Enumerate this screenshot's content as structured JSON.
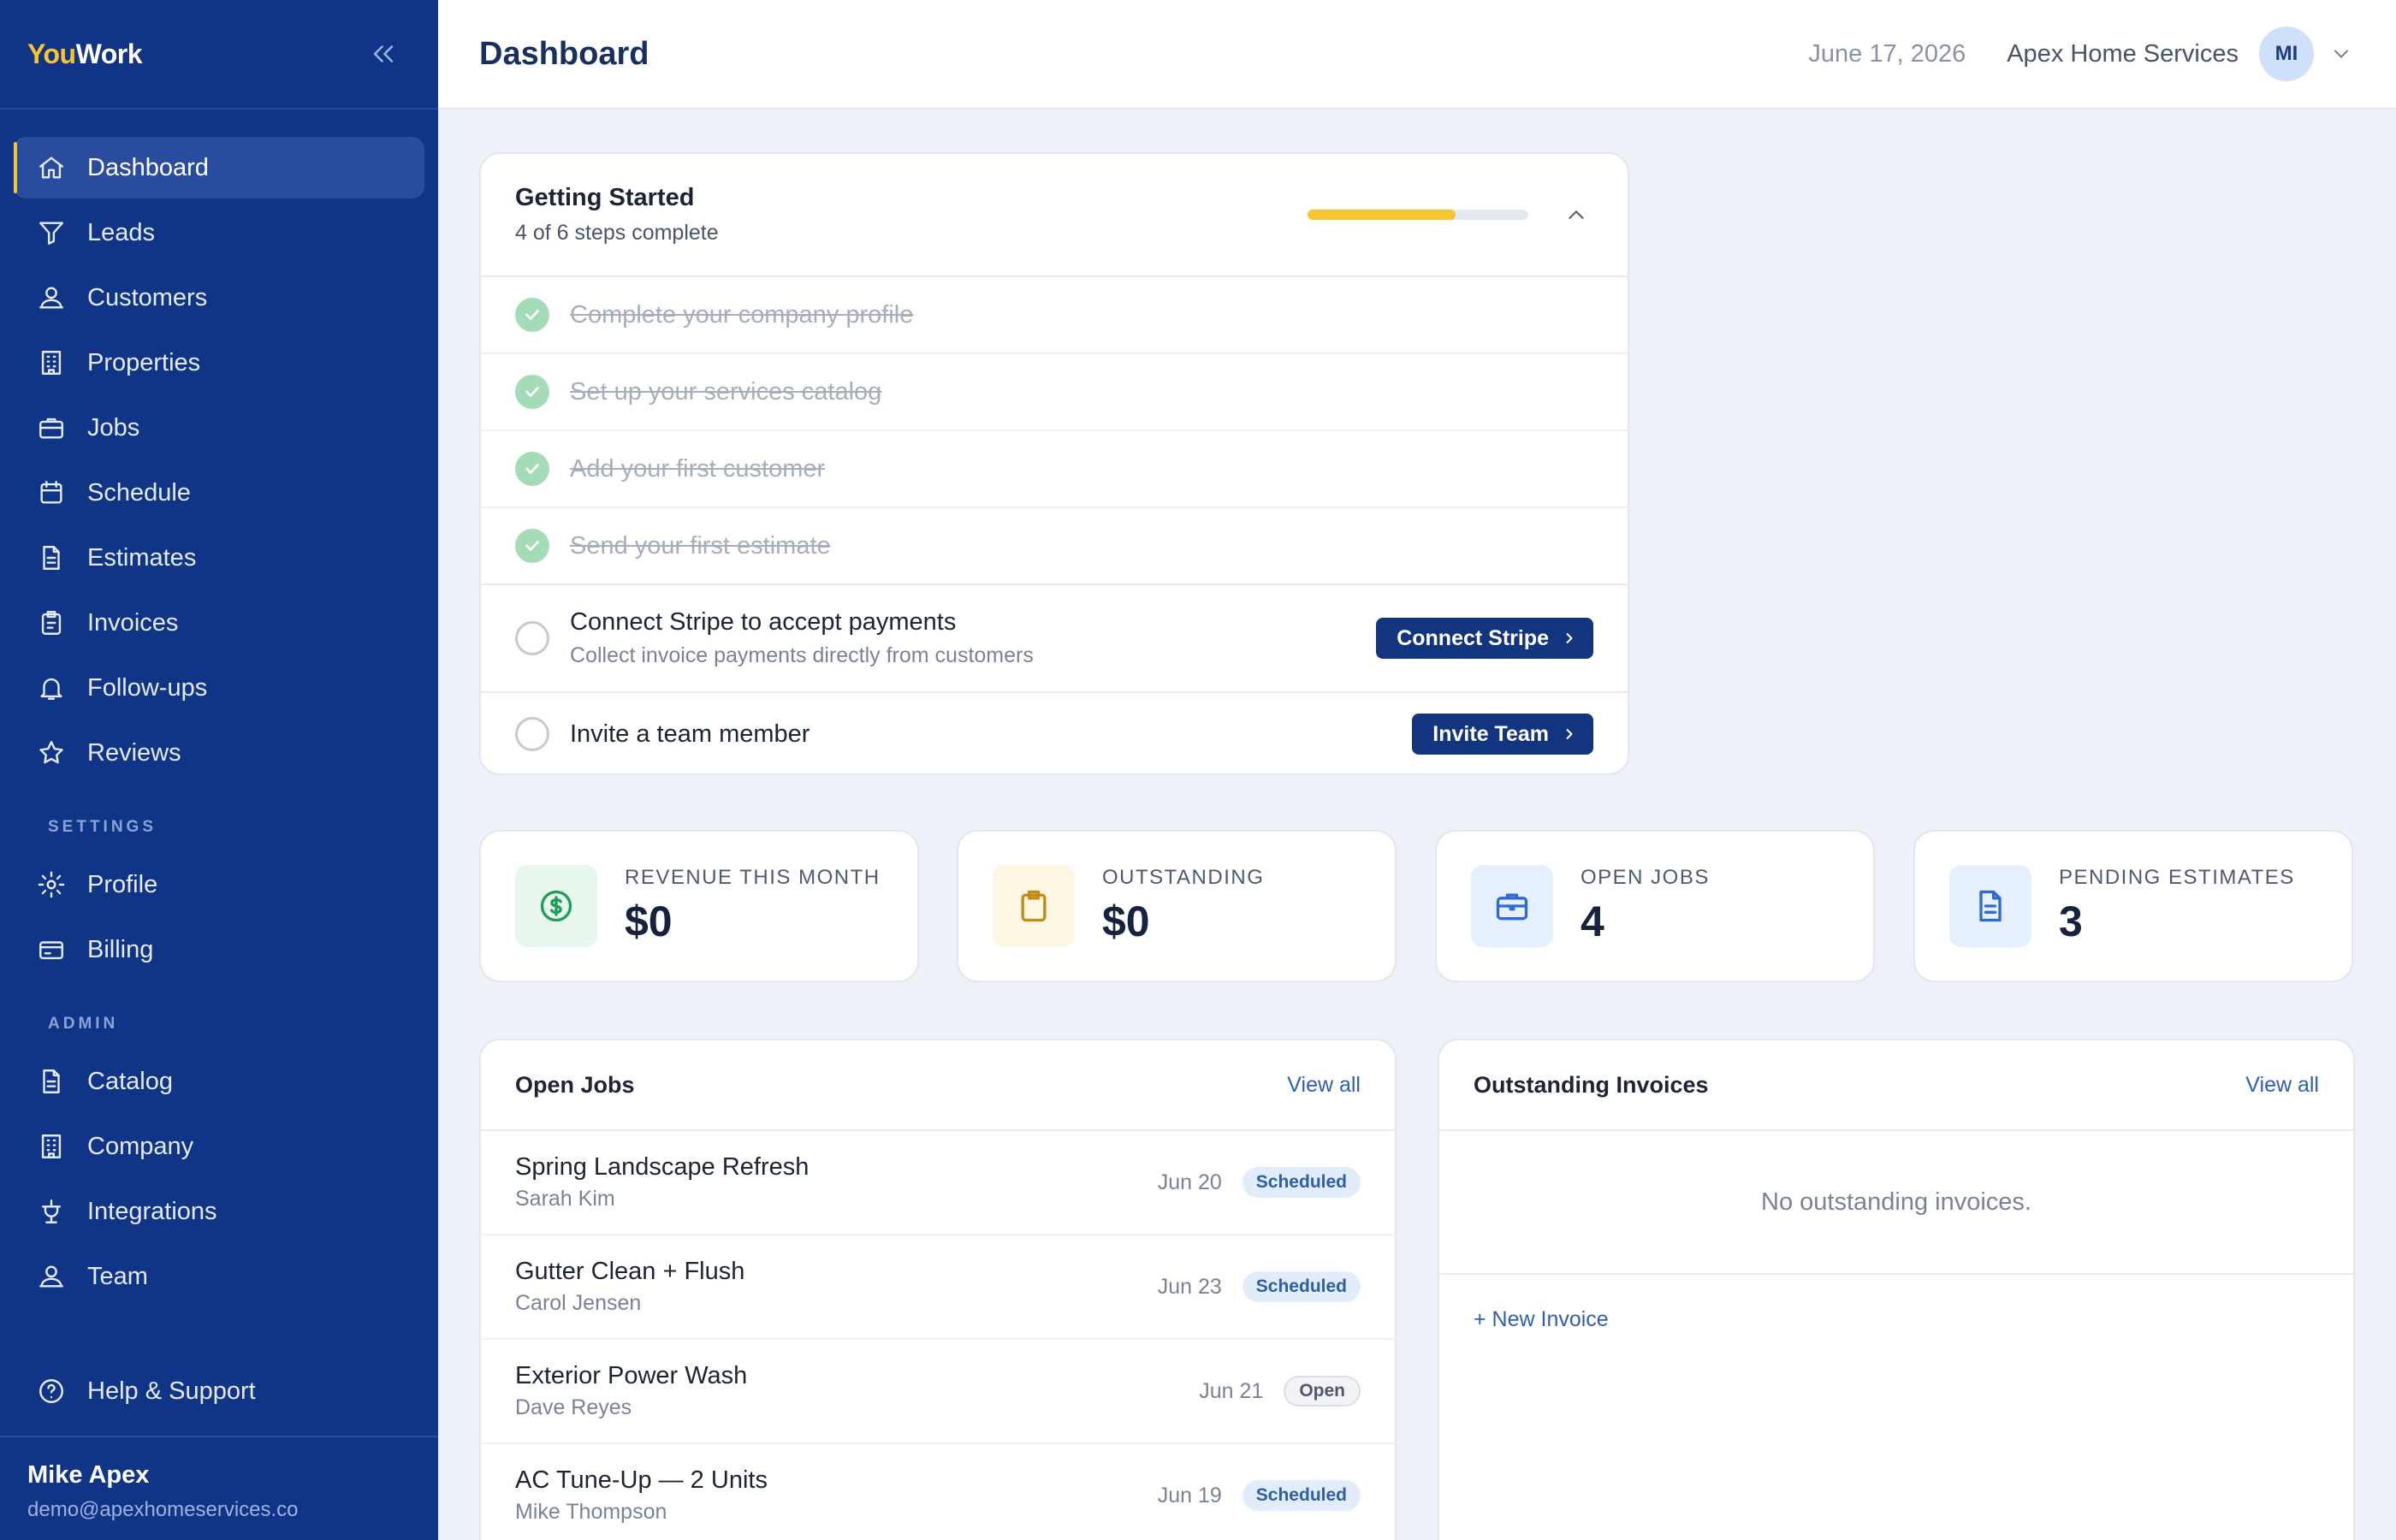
{
  "brand": {
    "part1": "You",
    "part2": "Work"
  },
  "sidebar": {
    "items": [
      {
        "label": "Dashboard",
        "icon": "home-icon",
        "active": true
      },
      {
        "label": "Leads",
        "icon": "funnel-icon"
      },
      {
        "label": "Customers",
        "icon": "user-icon"
      },
      {
        "label": "Properties",
        "icon": "building-icon"
      },
      {
        "label": "Jobs",
        "icon": "briefcase-icon"
      },
      {
        "label": "Schedule",
        "icon": "calendar-icon"
      },
      {
        "label": "Estimates",
        "icon": "document-icon"
      },
      {
        "label": "Invoices",
        "icon": "clipboard-icon"
      },
      {
        "label": "Follow-ups",
        "icon": "bell-icon"
      },
      {
        "label": "Reviews",
        "icon": "star-icon"
      }
    ],
    "settings_label": "SETTINGS",
    "settings_items": [
      {
        "label": "Profile",
        "icon": "gear-icon"
      },
      {
        "label": "Billing",
        "icon": "credit-card-icon"
      }
    ],
    "admin_label": "ADMIN",
    "admin_items": [
      {
        "label": "Catalog",
        "icon": "document-icon"
      },
      {
        "label": "Company",
        "icon": "building-icon"
      },
      {
        "label": "Integrations",
        "icon": "plug-icon"
      },
      {
        "label": "Team",
        "icon": "user-icon"
      }
    ],
    "help_label": "Help & Support",
    "user": {
      "name": "Mike Apex",
      "email": "demo@apexhomeservices.co"
    }
  },
  "header": {
    "title": "Dashboard",
    "date": "June 17, 2026",
    "company": "Apex Home Services",
    "avatar_initials": "MI"
  },
  "getting_started": {
    "title": "Getting Started",
    "subtitle": "4 of 6 steps complete",
    "progress": 0.67,
    "done_steps": [
      "Complete your company profile",
      "Set up your services catalog",
      "Add your first customer",
      "Send your first estimate"
    ],
    "stripe_step": {
      "title": "Connect Stripe to accept payments",
      "desc": "Collect invoice payments directly from customers",
      "button": "Connect Stripe"
    },
    "team_step": {
      "title": "Invite a team member",
      "button": "Invite Team"
    }
  },
  "stats": [
    {
      "label": "REVENUE THIS MONTH",
      "value": "$0",
      "icon": "dollar-icon",
      "color": "#1f9d55",
      "bg": "#e8f7ee"
    },
    {
      "label": "OUTSTANDING",
      "value": "$0",
      "icon": "clipboard-icon",
      "color": "#c28b12",
      "bg": "#fdf6e3"
    },
    {
      "label": "OPEN JOBS",
      "value": "4",
      "icon": "briefcase-icon",
      "color": "#2f6ad1",
      "bg": "#e6effc"
    },
    {
      "label": "PENDING ESTIMATES",
      "value": "3",
      "icon": "document-icon",
      "color": "#2f6ad1",
      "bg": "#e6effc"
    }
  ],
  "open_jobs": {
    "title": "Open Jobs",
    "view_all": "View all",
    "rows": [
      {
        "title": "Spring Landscape Refresh",
        "client": "Sarah Kim",
        "date": "Jun 20",
        "status": "Scheduled"
      },
      {
        "title": "Gutter Clean + Flush",
        "client": "Carol Jensen",
        "date": "Jun 23",
        "status": "Scheduled"
      },
      {
        "title": "Exterior Power Wash",
        "client": "Dave Reyes",
        "date": "Jun 21",
        "status": "Open"
      },
      {
        "title": "AC Tune-Up — 2 Units",
        "client": "Mike Thompson",
        "date": "Jun 19",
        "status": "Scheduled"
      }
    ]
  },
  "outstanding_invoices": {
    "title": "Outstanding Invoices",
    "view_all": "View all",
    "empty": "No outstanding invoices.",
    "new_link": "+ New Invoice"
  },
  "colors": {
    "sidebar": "#113586",
    "accent": "#f6c531",
    "primary_button": "#13347e",
    "link": "#2f5fb4"
  }
}
